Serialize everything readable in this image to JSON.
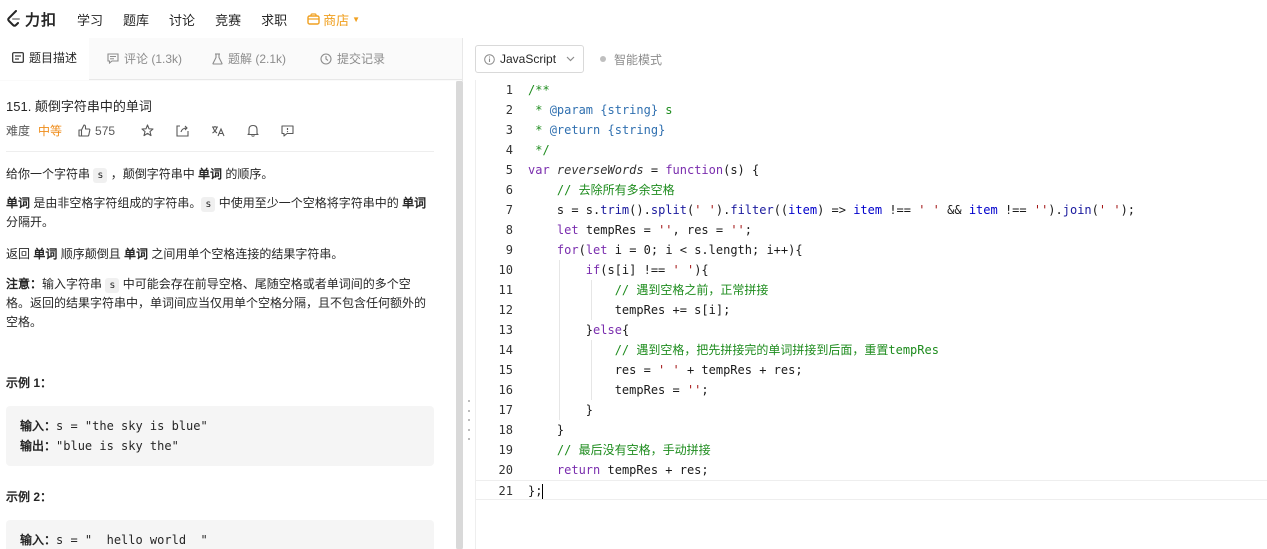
{
  "nav": {
    "logo_text": "力扣",
    "items": [
      "学习",
      "题库",
      "讨论",
      "竞赛",
      "求职"
    ],
    "store": "商店"
  },
  "tabs": [
    {
      "label": "题目描述",
      "icon": "document-icon"
    },
    {
      "label": "评论 (1.3k)",
      "icon": "comment-icon"
    },
    {
      "label": "题解 (2.1k)",
      "icon": "flask-icon"
    },
    {
      "label": "提交记录",
      "icon": "clock-icon"
    }
  ],
  "problem": {
    "title": "151. 颠倒字符串中的单词",
    "difficulty_label": "难度",
    "difficulty": "中等",
    "likes": "575",
    "p1_a": "给你一个字符串 ",
    "p1_code": "s",
    "p1_b": " ，颠倒字符串中 ",
    "p1_bold": "单词",
    "p1_c": " 的顺序。",
    "p2_bold1": "单词",
    "p2_a": " 是由非空格字符组成的字符串。",
    "p2_code": "s",
    "p2_b": " 中使用至少一个空格将字符串中的 ",
    "p2_bold2": "单词",
    "p2_c": " 分隔开。",
    "p3_a": "返回 ",
    "p3_bold1": "单词",
    "p3_b": " 顺序颠倒且 ",
    "p3_bold2": "单词",
    "p3_c": " 之间用单个空格连接的结果字符串。",
    "p4_bold": "注意：",
    "p4_a": "输入字符串 ",
    "p4_code": "s",
    "p4_b": " 中可能会存在前导空格、尾随空格或者单词间的多个空格。返回的结果字符串中，单词间应当仅用单个空格分隔，且不包含任何额外的空格。",
    "example1_title": "示例 1：",
    "example1_in_label": "输入：",
    "example1_in": "s = \"the sky is blue\"",
    "example1_out_label": "输出：",
    "example1_out": "\"blue is sky the\"",
    "example2_title": "示例 2：",
    "example2_in_label": "输入：",
    "example2_in": "s = \"  hello world  \""
  },
  "editor": {
    "language": "JavaScript",
    "smart_mode": "智能模式",
    "line_numbers": [
      "1",
      "2",
      "3",
      "4",
      "5",
      "6",
      "7",
      "8",
      "9",
      "10",
      "11",
      "12",
      "13",
      "14",
      "15",
      "16",
      "17",
      "18",
      "19",
      "20",
      "21"
    ],
    "code_lines": [
      "/**",
      " * @param {string} s",
      " * @return {string}",
      " */",
      "var reverseWords = function(s) {",
      "    // 去除所有多余空格",
      "    s = s.trim().split(' ').filter((item) => item !== ' ' && item !== '').join(' ');",
      "    let tempRes = '', res = '';",
      "    for(let i = 0; i < s.length; i++){",
      "        if(s[i] !== ' '){",
      "            // 遇到空格之前，正常拼接",
      "            tempRes += s[i];",
      "        }else{",
      "            // 遇到空格，把先拼接完的单词拼接到后面，重置tempRes",
      "            res = ' ' + tempRes + res;",
      "            tempRes = '';",
      "        }",
      "    }",
      "    // 最后没有空格，手动拼接",
      "    return tempRes + res;",
      "};"
    ]
  },
  "colors": {
    "accent_orange": "#ef8c19",
    "comment_green": "#1e8c1e",
    "keyword_purple": "#7a2dae"
  }
}
